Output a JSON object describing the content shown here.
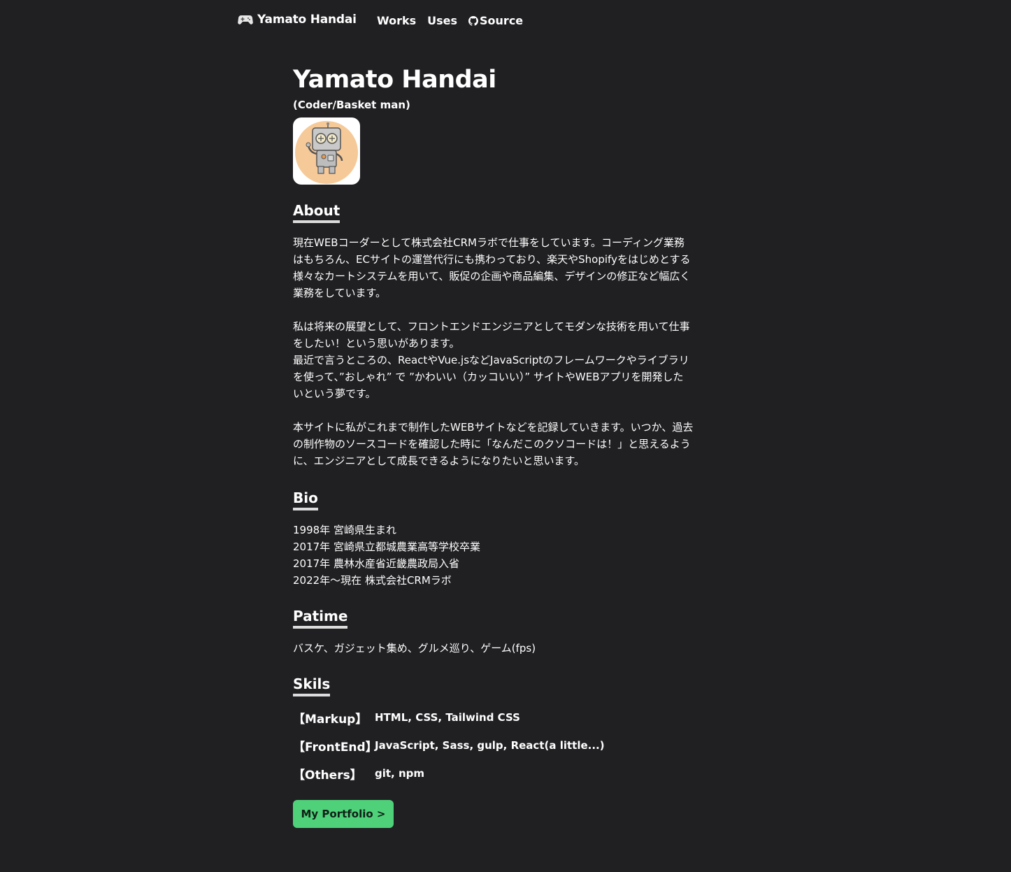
{
  "nav": {
    "brand": "Yamato Handai",
    "brand_icon": "gamepad-icon",
    "links": [
      {
        "label": "Works"
      },
      {
        "label": "Uses"
      },
      {
        "label": "Source",
        "icon": "github-icon"
      }
    ]
  },
  "profile": {
    "name": "Yamato Handai",
    "role": "(Coder/Basket man)",
    "avatar_icon": "robot-avatar"
  },
  "about": {
    "heading": "About",
    "paragraphs": [
      [
        "現在WEBコーダーとして株式会社CRMラボで仕事をしています。コーディング業務",
        "はもちろん、ECサイトの運営代行にも携わっており、楽天やShopifyをはじめとする",
        "様々なカートシステムを用いて、販促の企画や商品編集、デザインの修正など幅広く",
        "業務をしています。"
      ],
      [
        "私は将来の展望として、フロントエンドエンジニアとしてモダンな技術を用いて仕事",
        "をしたい！という思いがあります。",
        "最近で言うところの、ReactやVue.jsなどJavaScriptのフレームワークやライブラリ",
        "を使って、”おしゃれ” で ”かわいい（カッコいい）” サイトやWEBアプリを開発した",
        "いという夢です。"
      ],
      [
        "本サイトに私がこれまで制作したWEBサイトなどを記録していきます。いつか、過去",
        "の制作物のソースコードを確認した時に「なんだこのクソコードは！」と思えるよう",
        "に、エンジニアとして成長できるようになりたいと思います。"
      ]
    ]
  },
  "bio": {
    "heading": "Bio",
    "items": [
      "1998年 宮崎県生まれ",
      "2017年 宮崎県立都城農業高等学校卒業",
      "2017年 農林水産省近畿農政局入省",
      "2022年〜現在 株式会社CRMラボ"
    ]
  },
  "pastime": {
    "heading": "Patime",
    "text": "バスケ、ガジェット集め、グルメ巡り、ゲーム(fps)"
  },
  "skills": {
    "heading": "Skils",
    "rows": [
      {
        "category": "【Markup】",
        "value": "HTML, CSS, Tailwind CSS"
      },
      {
        "category": "【FrontEnd】",
        "value": "JavaScript, Sass, gulp, React(a little...)"
      },
      {
        "category": "【Others】",
        "value": "git, npm"
      }
    ]
  },
  "cta": {
    "label": "My Portfolio >",
    "color": "#4fd17a"
  },
  "colors": {
    "background": "#202023",
    "text": "#ffffff",
    "accent": "#4fd17a"
  }
}
